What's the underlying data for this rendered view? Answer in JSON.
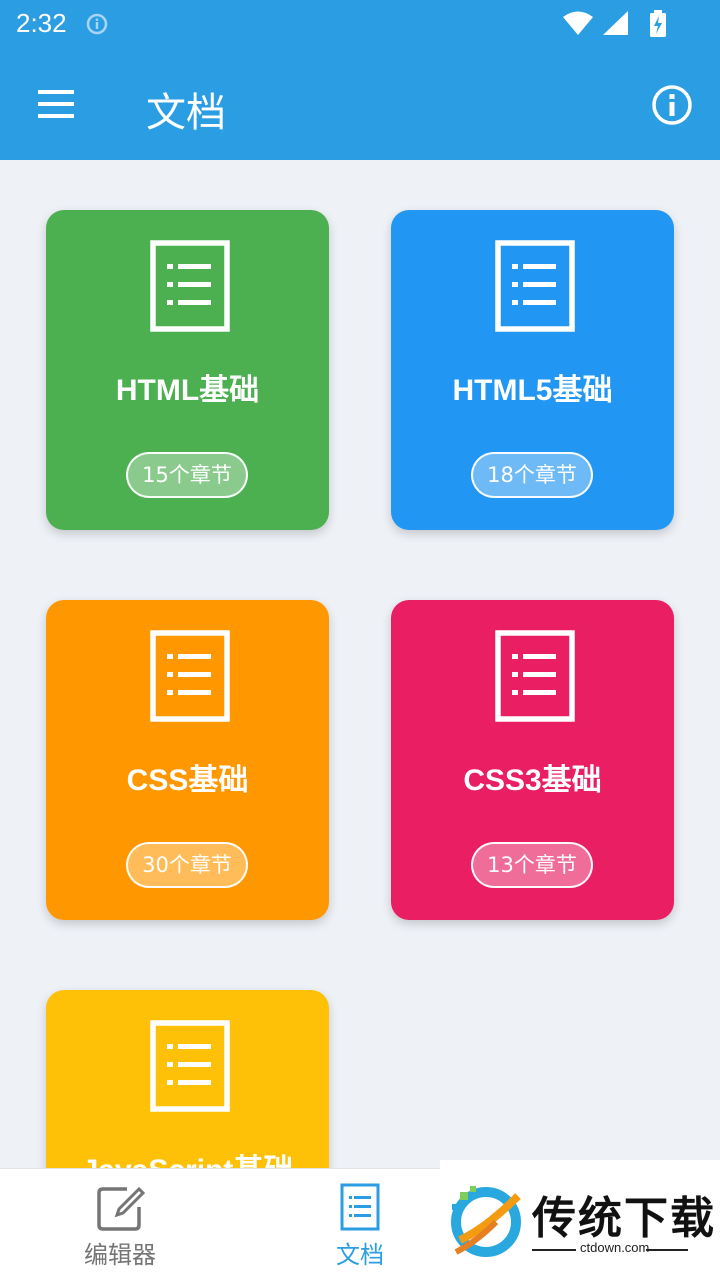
{
  "status_bar": {
    "time": "2:32"
  },
  "app_bar": {
    "title": "文档"
  },
  "cards": [
    {
      "title": "HTML基础",
      "badge": "15个章节",
      "color": "#4caf50"
    },
    {
      "title": "HTML5基础",
      "badge": "18个章节",
      "color": "#2196f3"
    },
    {
      "title": "CSS基础",
      "badge": "30个章节",
      "color": "#ff9800"
    },
    {
      "title": "CSS3基础",
      "badge": "13个章节",
      "color": "#e91e63"
    },
    {
      "title": "JavaScript基础",
      "badge": "",
      "color": "#ffc107"
    }
  ],
  "bottom_nav": {
    "items": [
      {
        "label": "编辑器",
        "icon": "edit-icon",
        "active": false
      },
      {
        "label": "文档",
        "icon": "document-list-icon",
        "active": true
      }
    ],
    "active_color": "#2b9ee3",
    "inactive_color": "#757575"
  },
  "watermark": {
    "text": "传统下载",
    "sub": "ctdown.com"
  }
}
